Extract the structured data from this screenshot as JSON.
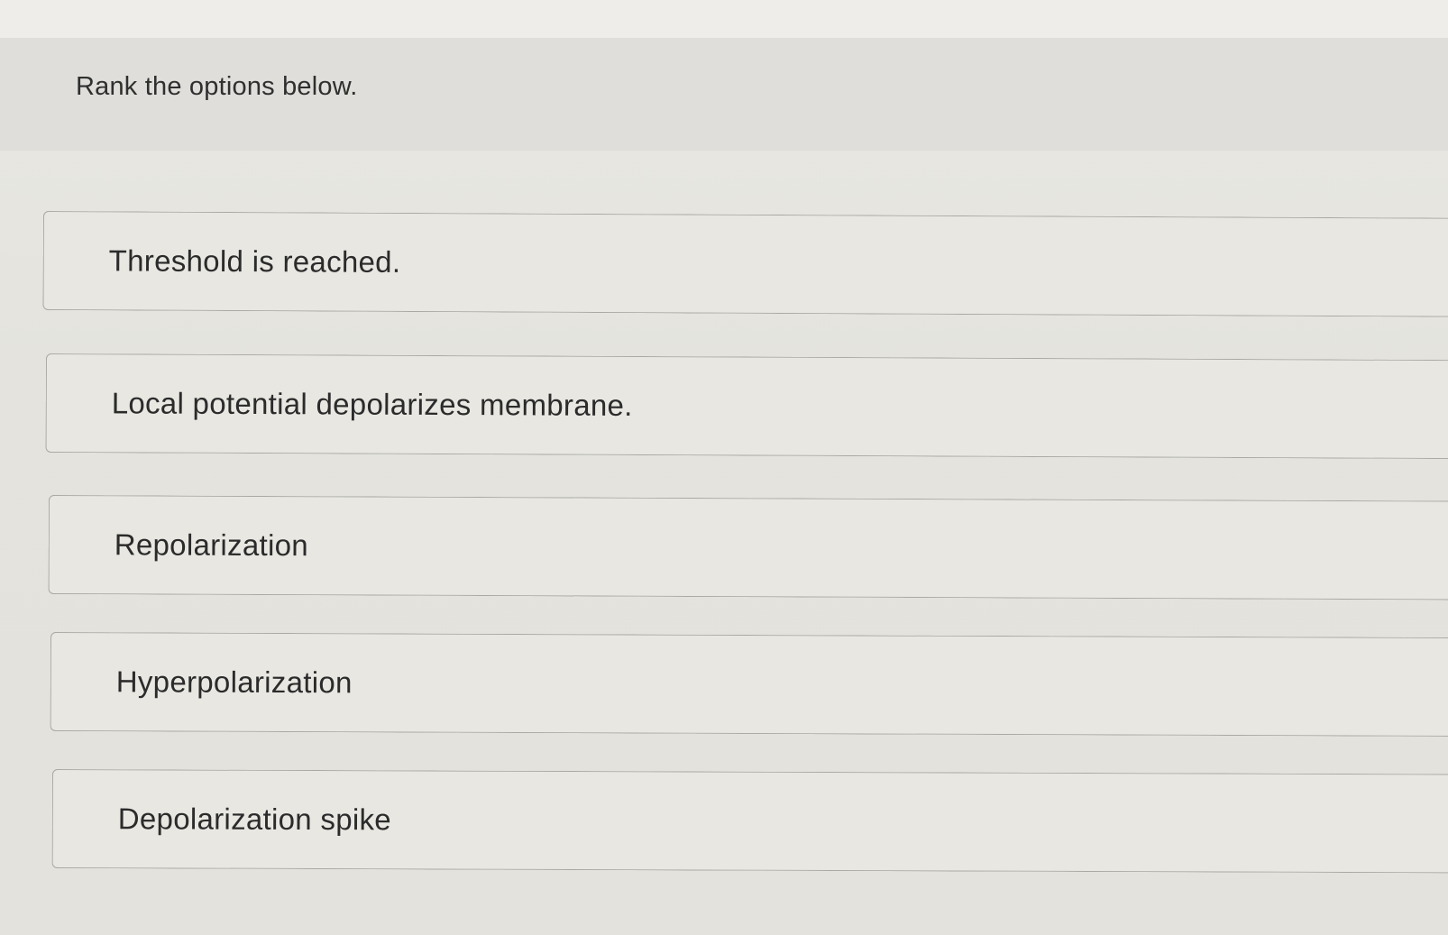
{
  "question": {
    "prompt": "Rank the options below."
  },
  "rank_options": [
    {
      "label": "Threshold is reached."
    },
    {
      "label": "Local potential depolarizes membrane."
    },
    {
      "label": "Repolarization"
    },
    {
      "label": "Hyperpolarization"
    },
    {
      "label": "Depolarization spike"
    }
  ]
}
